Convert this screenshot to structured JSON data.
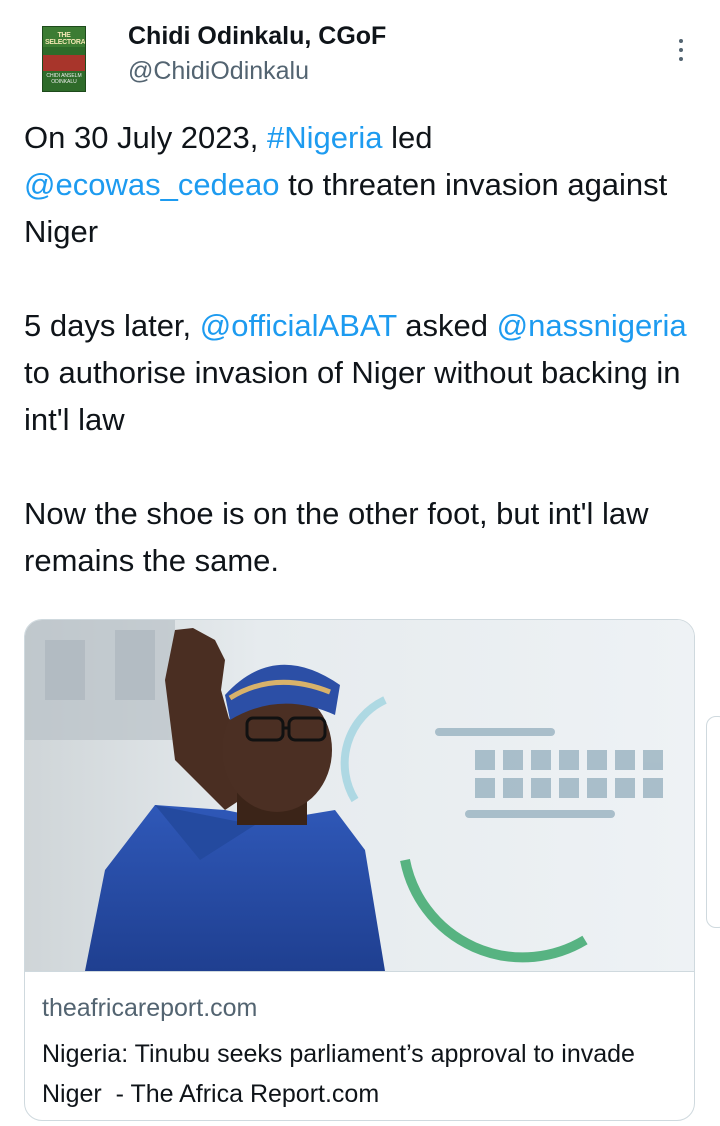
{
  "author": {
    "name": "Chidi Odinkalu, CGoF",
    "handle": "@ChidiOdinkalu",
    "avatar_book": {
      "title": "THE SELECTORATE",
      "author": "CHIDI ANSELM ODINKALU"
    }
  },
  "tweet": {
    "p1": {
      "t1": "On 30 July 2023, ",
      "l1": "#Nigeria",
      "t2": " led ",
      "l2": "@ecowas_cedeao",
      "t3": " to threaten invasion against Niger"
    },
    "p2": {
      "t1": "5 days later, ",
      "l1": "@officialABAT",
      "t2": " asked ",
      "l2": "@nassnigeria",
      "t3": " to authorise invasion of Niger without backing in int'l law"
    },
    "p3": {
      "t1": "Now the shoe is on the other foot, but int'l law remains the same."
    }
  },
  "link_card": {
    "domain": "theafricareport.com",
    "title": "Nigeria: Tinubu seeks parliament’s approval to invade Niger  - The Africa Report.com"
  },
  "colors": {
    "link": "#1d9bf0",
    "text": "#0f1419",
    "secondary": "#536471",
    "border": "#cfd9de"
  },
  "icons": {
    "more": "more-options-icon"
  }
}
